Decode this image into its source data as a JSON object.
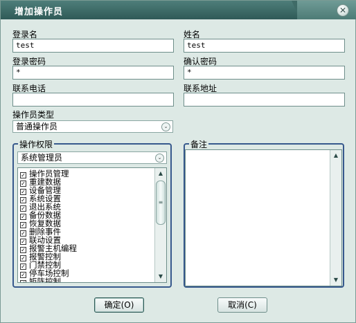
{
  "window": {
    "title": "增加操作员"
  },
  "form": {
    "login_label": "登录名",
    "login_value": "test",
    "name_label": "姓名",
    "name_value": "test",
    "password_label": "登录密码",
    "password_value": "*",
    "confirm_label": "确认密码",
    "confirm_value": "*",
    "phone_label": "联系电话",
    "phone_value": "",
    "address_label": "联系地址",
    "address_value": "",
    "type_label": "操作员类型",
    "type_value": "普通操作员"
  },
  "permissions": {
    "group_label": "操作权限",
    "role_value": "系统管理员",
    "items": [
      {
        "label": "操作员管理",
        "checked": true
      },
      {
        "label": "重建数据",
        "checked": true
      },
      {
        "label": "设备管理",
        "checked": true
      },
      {
        "label": "系统设置",
        "checked": true
      },
      {
        "label": "退出系统",
        "checked": true
      },
      {
        "label": "备份数据",
        "checked": true
      },
      {
        "label": "恢复数据",
        "checked": true
      },
      {
        "label": "删除事件",
        "checked": true
      },
      {
        "label": "联动设置",
        "checked": true
      },
      {
        "label": "报警主机编程",
        "checked": true
      },
      {
        "label": "报警控制",
        "checked": true
      },
      {
        "label": "门禁控制",
        "checked": true
      },
      {
        "label": "停车场控制",
        "checked": true
      },
      {
        "label": "矩阵控制",
        "checked": true
      }
    ]
  },
  "notes": {
    "label": "备注",
    "value": ""
  },
  "buttons": {
    "ok": "确定(O)",
    "cancel": "取消(C)"
  },
  "icons": {
    "close": "close-icon",
    "dropdown": "chevron-down-icon",
    "check": "checkbox-checked-icon"
  }
}
